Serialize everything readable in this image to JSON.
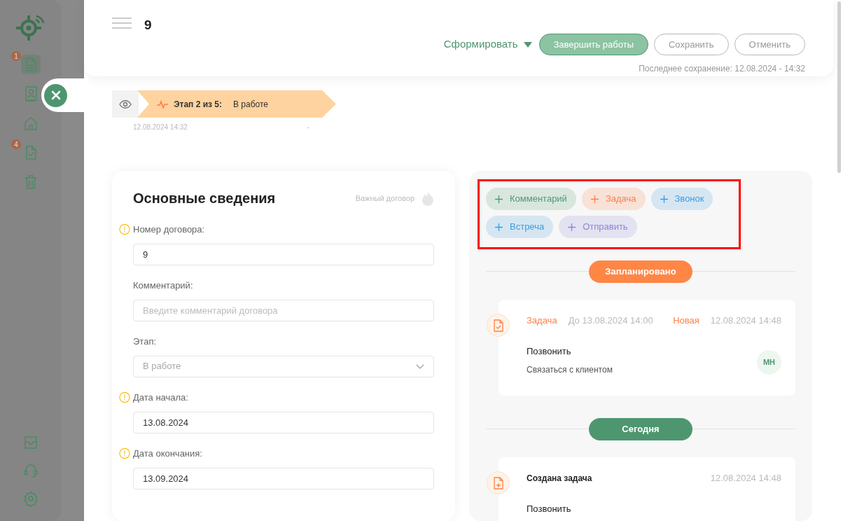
{
  "sidebar": {
    "items": [
      {
        "kind": "document",
        "badge": "1",
        "selected": true
      },
      {
        "kind": "contacts",
        "selected": false
      },
      {
        "kind": "home",
        "selected": false
      },
      {
        "kind": "task",
        "badge": "4",
        "selected": false
      },
      {
        "kind": "trash",
        "selected": false
      }
    ],
    "bottom_items": [
      {
        "kind": "inbox"
      },
      {
        "kind": "headset"
      },
      {
        "kind": "settings"
      }
    ]
  },
  "header": {
    "title": "9",
    "generate": "Сформировать",
    "buttons": [
      {
        "label": "Завершить работы",
        "kind": "primary"
      },
      {
        "label": "Сохранить",
        "kind": "outline"
      },
      {
        "label": "Отменить",
        "kind": "outline"
      }
    ],
    "last_saved": "Последнее сохранение: 12.08.2024 - 14:32"
  },
  "stage": {
    "label": "Этап 2 из 5:",
    "value": "В работе",
    "date": "12.08.2024 14:32",
    "end": "-"
  },
  "main_info": {
    "title": "Основные сведения",
    "important_label": "Важный договор",
    "important": false,
    "fields": [
      {
        "label": "Номер договора:",
        "required": true,
        "kind": "input",
        "value": "9"
      },
      {
        "label": "Комментарий:",
        "required": false,
        "kind": "input",
        "placeholder": "Введите комментарий договора"
      },
      {
        "label": "Этап:",
        "required": false,
        "kind": "select",
        "value": "В работе",
        "disabled": true
      },
      {
        "label": "Дата начала:",
        "required": true,
        "kind": "input",
        "value": "13.08.2024"
      },
      {
        "label": "Дата окончания:",
        "required": true,
        "kind": "input",
        "value": "13.09.2024"
      }
    ]
  },
  "actions": [
    {
      "label": "Комментарий",
      "color": "#4e9a70"
    },
    {
      "label": "Задача",
      "color": "#ff7f45"
    },
    {
      "label": "Звонок",
      "color": "#3f9ae0"
    },
    {
      "label": "Встреча",
      "color": "#3f9ae0"
    },
    {
      "label": "Отправить",
      "color": "#8a86d6"
    }
  ],
  "timeline": [
    {
      "section": "Запланировано",
      "color": "#ff8645",
      "events": [
        {
          "kind": "task",
          "type": "Задача",
          "due": "До 13.08.2024 14:00",
          "status": "Новая",
          "time": "12.08.2024 14:48",
          "title": "Позвонить",
          "text": "Связаться с клиентом",
          "avatar": "МН"
        }
      ]
    },
    {
      "section": "Сегодня",
      "color": "#4e9670",
      "events": [
        {
          "kind": "created",
          "type": "Создана задача",
          "time": "12.08.2024 14:48",
          "title": "Позвонить"
        }
      ]
    }
  ]
}
